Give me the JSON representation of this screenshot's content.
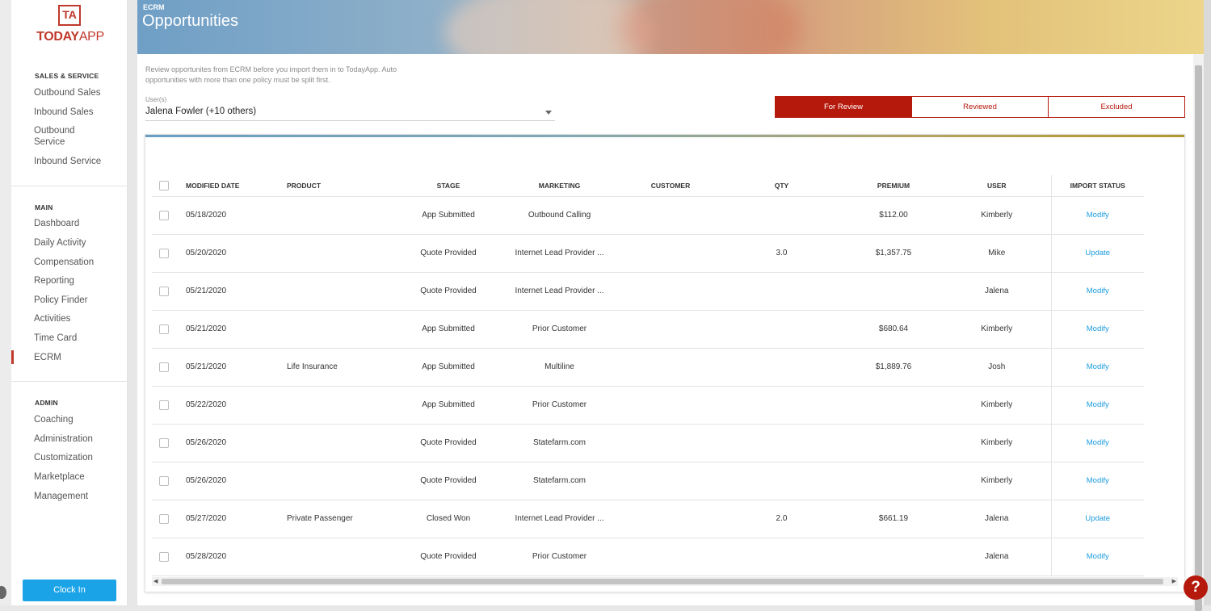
{
  "sidebar": {
    "logo_badge": "TA",
    "logo_today": "TODAY",
    "logo_app": "APP",
    "sections": [
      {
        "heading": "SALES & SERVICE",
        "items": [
          "Outbound Sales",
          "Inbound Sales",
          "Outbound Service",
          "Inbound Service"
        ]
      },
      {
        "heading": "MAIN",
        "items": [
          "Dashboard",
          "Daily Activity",
          "Compensation",
          "Reporting",
          "Policy Finder",
          "Activities",
          "Time Card",
          "ECRM"
        ]
      },
      {
        "heading": "ADMIN",
        "items": [
          "Coaching",
          "Administration",
          "Customization",
          "Marketplace",
          "Management"
        ]
      }
    ],
    "active_item": "ECRM",
    "clock_in_label": "Clock In"
  },
  "header": {
    "breadcrumb": "ECRM",
    "title": "Opportunities"
  },
  "intro_text": "Review opportunites from ECRM before you import them in to TodayApp. Auto opportunities with more than one policy must be split first.",
  "user_filter": {
    "label": "User(s)",
    "value": "Jalena Fowler (+10 others)"
  },
  "tabs": [
    {
      "label": "For Review",
      "active": true
    },
    {
      "label": "Reviewed",
      "active": false
    },
    {
      "label": "Excluded",
      "active": false
    }
  ],
  "table": {
    "columns": [
      "MODIFIED DATE",
      "PRODUCT",
      "STAGE",
      "MARKETING",
      "CUSTOMER",
      "QTY",
      "PREMIUM",
      "USER",
      "IMPORT STATUS"
    ],
    "rows": [
      {
        "date": "05/18/2020",
        "product": "",
        "stage": "App Submitted",
        "marketing": "Outbound Calling",
        "customer": "",
        "qty": "",
        "premium": "$112.00",
        "user": "Kimberly",
        "status": "Modify"
      },
      {
        "date": "05/20/2020",
        "product": "",
        "stage": "Quote Provided",
        "marketing": "Internet Lead Provider ...",
        "customer": "",
        "qty": "3.0",
        "premium": "$1,357.75",
        "user": "Mike",
        "status": "Update"
      },
      {
        "date": "05/21/2020",
        "product": "",
        "stage": "Quote Provided",
        "marketing": "Internet Lead Provider ...",
        "customer": "",
        "qty": "",
        "premium": "",
        "user": "Jalena",
        "status": "Modify"
      },
      {
        "date": "05/21/2020",
        "product": "",
        "stage": "App Submitted",
        "marketing": "Prior Customer",
        "customer": "",
        "qty": "",
        "premium": "$680.64",
        "user": "Kimberly",
        "status": "Modify"
      },
      {
        "date": "05/21/2020",
        "product": "Life Insurance",
        "stage": "App Submitted",
        "marketing": "Multiline",
        "customer": "",
        "qty": "",
        "premium": "$1,889.76",
        "user": "Josh",
        "status": "Modify"
      },
      {
        "date": "05/22/2020",
        "product": "",
        "stage": "App Submitted",
        "marketing": "Prior Customer",
        "customer": "",
        "qty": "",
        "premium": "",
        "user": "Kimberly",
        "status": "Modify"
      },
      {
        "date": "05/26/2020",
        "product": "",
        "stage": "Quote Provided",
        "marketing": "Statefarm.com",
        "customer": "",
        "qty": "",
        "premium": "",
        "user": "Kimberly",
        "status": "Modify"
      },
      {
        "date": "05/26/2020",
        "product": "",
        "stage": "Quote Provided",
        "marketing": "Statefarm.com",
        "customer": "",
        "qty": "",
        "premium": "",
        "user": "Kimberly",
        "status": "Modify"
      },
      {
        "date": "05/27/2020",
        "product": "Private Passenger",
        "stage": "Closed Won",
        "marketing": "Internet Lead Provider ...",
        "customer": "",
        "qty": "2.0",
        "premium": "$661.19",
        "user": "Jalena",
        "status": "Update"
      },
      {
        "date": "05/28/2020",
        "product": "",
        "stage": "Quote Provided",
        "marketing": "Prior Customer",
        "customer": "",
        "qty": "",
        "premium": "",
        "user": "Jalena",
        "status": "Modify"
      }
    ]
  },
  "help_label": "?",
  "colors": {
    "brand_red": "#b5190c",
    "link_blue": "#1a9be0",
    "clock_in_blue": "#1aa3e6"
  }
}
